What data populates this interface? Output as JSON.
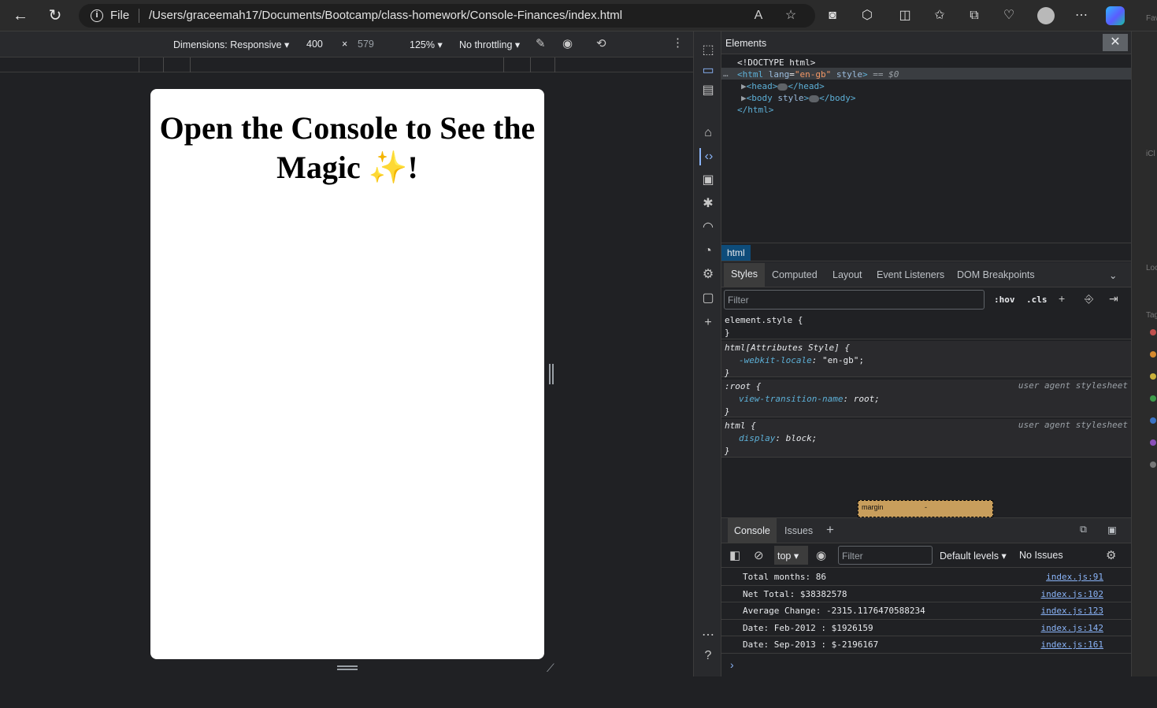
{
  "browser": {
    "file_label": "File",
    "url": "/Users/graceemah17/Documents/Bootcamp/class-homework/Console-Finances/index.html"
  },
  "device_toolbar": {
    "dimensions": "Dimensions: Responsive",
    "width": "400",
    "times": "×",
    "height": "579",
    "zoom": "125%",
    "throttling": "No throttling"
  },
  "page": {
    "heading": "Open the Console to See the Magic",
    "sparkle": "✨",
    "bang": "!"
  },
  "devtools": {
    "panel_title": "Elements",
    "dom": {
      "doctype": "<!DOCTYPE html>",
      "html_open_tag": "<html",
      "lang_attr": "lang",
      "lang_val": "\"en-gb\"",
      "style_attr": "style",
      "html_close_bracket": ">",
      "selected_marker": "== $0",
      "head_open": "<head>",
      "head_close": "</head>",
      "body_open_tag": "<body",
      "body_style": "style",
      "body_open_end": ">",
      "body_close": "</body>",
      "html_close": "</html>"
    },
    "breadcrumb": "html",
    "subtabs": [
      "Styles",
      "Computed",
      "Layout",
      "Event Listeners",
      "DOM Breakpoints"
    ],
    "filter_placeholder": "Filter",
    "hov": ":hov",
    "cls": ".cls",
    "rules": [
      {
        "selector": "element.style {",
        "close": "}"
      },
      {
        "selector": "html[Attributes Style] {",
        "prop": "-webkit-locale",
        "value": "\"en-gb\";",
        "close": "}"
      },
      {
        "selector": ":root {",
        "origin": "user agent stylesheet",
        "prop": "view-transition-name",
        "value": "root;",
        "close": "}"
      },
      {
        "selector": "html {",
        "origin": "user agent stylesheet",
        "prop": "display",
        "value": "block;",
        "close": "}"
      }
    ],
    "box_model": {
      "label": "margin",
      "value": "-"
    }
  },
  "console": {
    "tabs": [
      "Console",
      "Issues"
    ],
    "context": "top",
    "filter_placeholder": "Filter",
    "levels": "Default levels",
    "issues": "No Issues",
    "logs": [
      {
        "message": "Total months: 86",
        "source": "index.js:91"
      },
      {
        "message": "Net Total: $38382578",
        "source": "index.js:102"
      },
      {
        "message": "Average Change: -2315.1176470588234",
        "source": "index.js:123"
      },
      {
        "message": "Date: Feb-2012 : $1926159",
        "source": "index.js:142"
      },
      {
        "message": "Date: Sep-2013 : $-2196167",
        "source": "index.js:161"
      }
    ]
  },
  "side_strip": {
    "labels": [
      "Fav",
      "iCl",
      "Loc",
      "Tag"
    ]
  },
  "colors": {
    "accent": "#8ab4f8",
    "selection": "#0e4c7a",
    "sparkle": "#f4c430"
  }
}
